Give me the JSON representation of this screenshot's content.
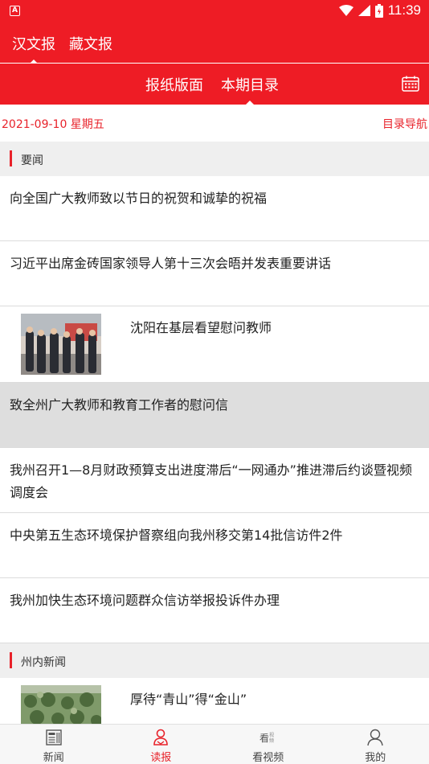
{
  "status_bar": {
    "time": "11:39",
    "app_icon": "A"
  },
  "paper_tabs": [
    {
      "label": "汉文报",
      "active": true
    },
    {
      "label": "藏文报",
      "active": false
    }
  ],
  "view_tabs": [
    {
      "label": "报纸版面",
      "active": false
    },
    {
      "label": "本期目录",
      "active": true
    }
  ],
  "date_bar": {
    "date": "2021-09-10  星期五",
    "nav_link": "目录导航"
  },
  "sections": [
    {
      "title": "要闻",
      "articles": [
        {
          "title": "向全国广大教师致以节日的祝贺和诚挚的祝福"
        },
        {
          "title": "习近平出席金砖国家领导人第十三次会晤并发表重要讲话"
        },
        {
          "title": "沈阳在基层看望慰问教师",
          "has_image": true
        },
        {
          "title": "致全州广大教师和教育工作者的慰问信",
          "highlighted": true
        },
        {
          "title": "我州召开1—8月财政预算支出进度滞后“一网通办”推进滞后约谈暨视频调度会"
        },
        {
          "title": "中央第五生态环境保护督察组向我州移交第14批信访件2件"
        },
        {
          "title": "我州加快生态环境问题群众信访举报投诉件办理"
        }
      ]
    },
    {
      "title": "州内新闻",
      "articles": [
        {
          "title": "厚待“青山”得“金山”",
          "has_image": true
        }
      ]
    }
  ],
  "bottom_nav": [
    {
      "label": "新闻",
      "icon": "newspaper-icon",
      "active": false
    },
    {
      "label": "读报",
      "icon": "reader-icon",
      "active": true
    },
    {
      "label": "看视频",
      "icon": "video-icon",
      "active": false
    },
    {
      "label": "我的",
      "icon": "profile-icon",
      "active": false
    }
  ],
  "colors": {
    "brand_red": "#ee1c25",
    "accent_red": "#e8222a",
    "section_bg": "#efefef",
    "highlight_bg": "#dedede"
  }
}
